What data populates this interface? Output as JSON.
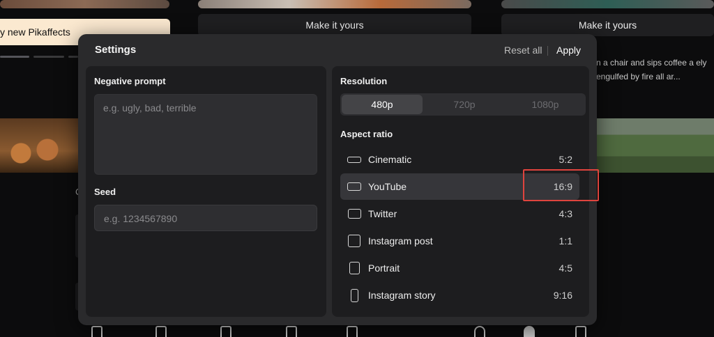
{
  "background": {
    "make_buttons": [
      "Make it yours",
      "Make it yours"
    ],
    "banner_text": "y new Pikaffects",
    "description": "n a chair and sips coffee a ely engulfed by fire all ar...",
    "side_letter": "C"
  },
  "settings": {
    "title": "Settings",
    "reset_label": "Reset all",
    "apply_label": "Apply",
    "negative_prompt": {
      "label": "Negative prompt",
      "placeholder": "e.g. ugly, bad, terrible"
    },
    "seed": {
      "label": "Seed",
      "placeholder": "e.g. 1234567890"
    },
    "resolution": {
      "label": "Resolution",
      "options": [
        "480p",
        "720p",
        "1080p"
      ],
      "selected": "480p"
    },
    "aspect_ratio": {
      "label": "Aspect ratio",
      "selected": "YouTube",
      "options": [
        {
          "name": "Cinematic",
          "ratio": "5:2",
          "icon": "ratio-5-2-icon"
        },
        {
          "name": "YouTube",
          "ratio": "16:9",
          "icon": "ratio-16-9-icon"
        },
        {
          "name": "Twitter",
          "ratio": "4:3",
          "icon": "ratio-4-3-icon"
        },
        {
          "name": "Instagram post",
          "ratio": "1:1",
          "icon": "ratio-1-1-icon"
        },
        {
          "name": "Portrait",
          "ratio": "4:5",
          "icon": "ratio-4-5-icon"
        },
        {
          "name": "Instagram story",
          "ratio": "9:16",
          "icon": "ratio-9-16-icon"
        }
      ]
    }
  },
  "colors": {
    "highlight": "#e0443e",
    "modal_bg": "#2a2a2c",
    "panel_bg": "#1d1d1f"
  }
}
